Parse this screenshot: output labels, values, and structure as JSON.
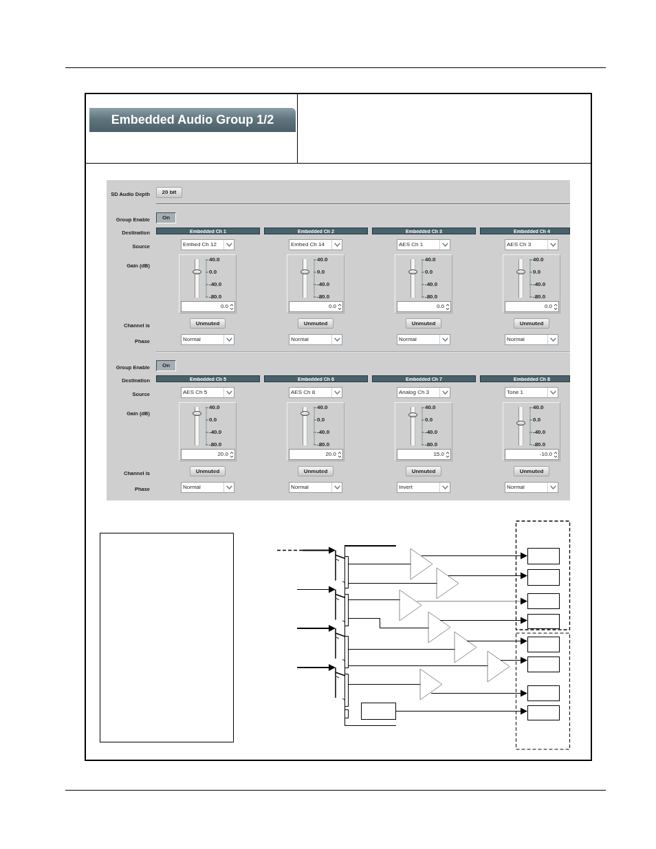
{
  "header": {
    "title": "Embedded Audio Group 1/2"
  },
  "panel": {
    "sd_audio_depth": {
      "label": "SD Audio Depth",
      "value": "20 bit"
    },
    "groups": [
      {
        "labels": {
          "group_enable": "Group Enable",
          "destination": "Destination",
          "source": "Source",
          "gain": "Gain (dB)",
          "channel": "Channel is",
          "phase": "Phase"
        },
        "group_enable": {
          "label": "On",
          "on": true
        },
        "channels": [
          {
            "destination": "Embedded Ch 1",
            "source": "Embed Ch 12",
            "scale": [
              "40.0",
              "0.0",
              "-40.0",
              "-80.0"
            ],
            "level": 0.667,
            "gain": "0.0",
            "channel_state": "Unmuted",
            "phase": "Normal"
          },
          {
            "destination": "Embedded Ch 2",
            "source": "Embed Ch 14",
            "scale": [
              "40.0",
              "0.0",
              "-40.0",
              "-80.0"
            ],
            "level": 0.667,
            "gain": "0.0",
            "channel_state": "Unmuted",
            "phase": "Normal"
          },
          {
            "destination": "Embedded Ch 3",
            "source": "AES Ch 1",
            "scale": [
              "40.0",
              "0.0",
              "-40.0",
              "-80.0"
            ],
            "level": 0.667,
            "gain": "0.0",
            "channel_state": "Unmuted",
            "phase": "Normal"
          },
          {
            "destination": "Embedded Ch 4",
            "source": "AES Ch 3",
            "scale": [
              "40.0",
              "0.0",
              "-40.0",
              "-80.0"
            ],
            "level": 0.667,
            "gain": "0.0",
            "channel_state": "Unmuted",
            "phase": "Normal"
          }
        ]
      },
      {
        "labels": {
          "group_enable": "Group Enable",
          "destination": "Destination",
          "source": "Source",
          "gain": "Gain (dB)",
          "channel": "Channel is",
          "phase": "Phase"
        },
        "group_enable": {
          "label": "On",
          "on": true
        },
        "channels": [
          {
            "destination": "Embedded Ch 5",
            "source": "AES Ch 5",
            "scale": [
              "40.0",
              "0.0",
              "-40.0",
              "-80.0"
            ],
            "level": 0.833,
            "gain": "20.0",
            "channel_state": "Unmuted",
            "phase": "Normal"
          },
          {
            "destination": "Embedded Ch 6",
            "source": "AES Ch 8",
            "scale": [
              "40.0",
              "0.0",
              "-40.0",
              "-80.0"
            ],
            "level": 0.833,
            "gain": "20.0",
            "channel_state": "Unmuted",
            "phase": "Normal"
          },
          {
            "destination": "Embedded Ch 7",
            "source": "Analog Ch 3",
            "scale": [
              "40.0",
              "0.0",
              "-40.0",
              "-80.0"
            ],
            "level": 0.792,
            "gain": "15.0",
            "channel_state": "Unmuted",
            "phase": "Invert"
          },
          {
            "destination": "Embedded Ch 8",
            "source": "Tone 1",
            "scale": [
              "40.0",
              "0.0",
              "-40.0",
              "-80.0"
            ],
            "level": 0.583,
            "gain": "-10.0",
            "channel_state": "Unmuted",
            "phase": "Normal"
          }
        ]
      }
    ]
  }
}
